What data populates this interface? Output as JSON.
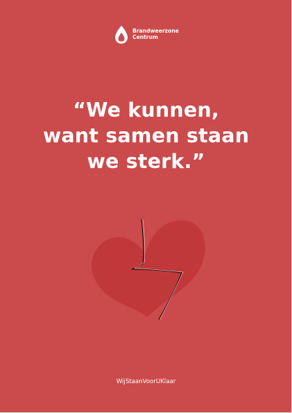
{
  "brand": {
    "line1": "Brandweerzone",
    "line2": "Centrum"
  },
  "quote": {
    "line1": "“We kunnen,",
    "line2": "want samen staan",
    "line3": "we sterk.”"
  },
  "hashtag": "WijStaanVoorUKlaar",
  "colors": {
    "background": "#cb4a4b",
    "heart": "#c1383b",
    "crack": "#111111",
    "text": "#ffffff"
  },
  "icons": {
    "logo": "flame-drop-icon",
    "illustration": "broken-heart-icon"
  }
}
